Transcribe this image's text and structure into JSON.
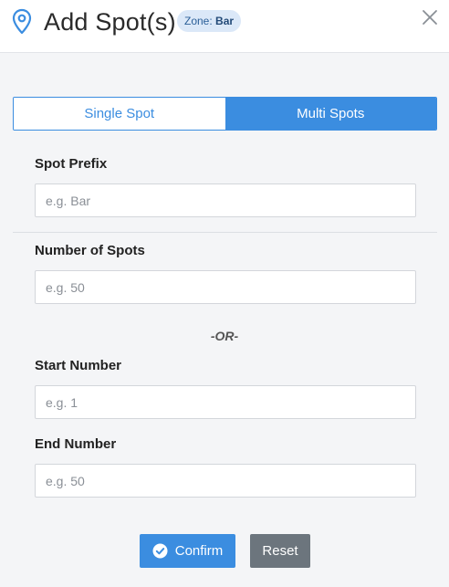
{
  "header": {
    "title": "Add Spot(s)",
    "zone_label": "Zone:",
    "zone_value": "Bar",
    "icon": "map-pin-icon",
    "close_icon": "close-icon"
  },
  "tabs": [
    {
      "label": "Single Spot",
      "active": false
    },
    {
      "label": "Multi Spots",
      "active": true
    }
  ],
  "form": {
    "prefix": {
      "label": "Spot Prefix",
      "placeholder": "e.g. Bar",
      "value": ""
    },
    "number_of_spots": {
      "label": "Number of Spots",
      "placeholder": "e.g. 50",
      "value": ""
    },
    "or_text": "-OR-",
    "start_number": {
      "label": "Start Number",
      "placeholder": "e.g. 1",
      "value": ""
    },
    "end_number": {
      "label": "End Number",
      "placeholder": "e.g. 50",
      "value": ""
    }
  },
  "actions": {
    "confirm_label": "Confirm",
    "reset_label": "Reset"
  },
  "colors": {
    "primary": "#3b8de0",
    "secondary": "#6c757d",
    "badge_bg": "#dbe8f8"
  }
}
